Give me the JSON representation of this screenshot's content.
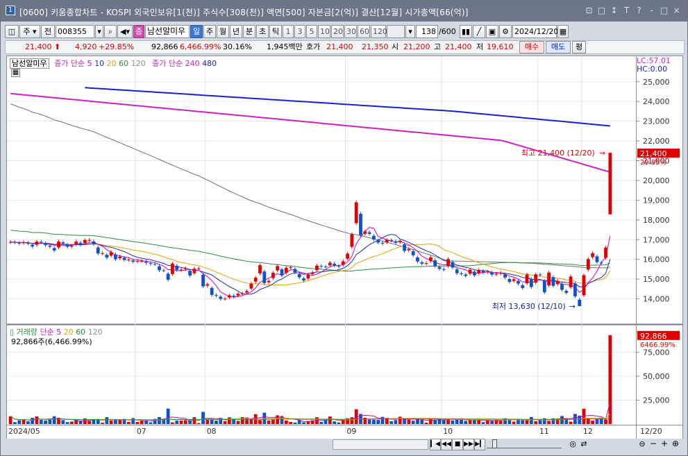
{
  "window": {
    "icon_label": "1",
    "title": "[0600] 키움종합차트 - KOSPI 외국인보유[1(천)] 주식수[308(천)] 액면[500] 자본금[2(억)] 결산[12월] 시가총액[66(억)]",
    "controls": [
      "⊡",
      "□",
      "↕",
      "T",
      "?",
      "-",
      "□",
      "×"
    ]
  },
  "toolbar": {
    "tool_icon": "◫",
    "market": "주",
    "prev_label": "전",
    "code": "008355",
    "name": "남선알미우",
    "periods": [
      "일",
      "주",
      "월",
      "년",
      "분",
      "초",
      "틱"
    ],
    "selected_period": "일",
    "intervals": [
      "1",
      "3",
      "5",
      "10",
      "20",
      "30",
      "60",
      "120"
    ],
    "count": "138",
    "count_total": "/600",
    "date": "2024/12/20",
    "jong_label": "종"
  },
  "quote": {
    "price": "21,400",
    "change": "4,920",
    "change_pct": "+29.85%",
    "volume": "92,866",
    "volume_pct": "6,466.99%",
    "turnover_pct": "30.16%",
    "amount": "1,945백만",
    "bid_label": "호가",
    "ask": "21,400",
    "bid": "21,350",
    "open_label": "시",
    "open": "21,200",
    "high_label": "고",
    "high": "21,400",
    "low_label": "저",
    "low": "19,610",
    "buy_label": "매수",
    "sell_label": "매도",
    "eval_label": "평"
  },
  "price_panel": {
    "legend_name": "남선알미우",
    "ma_label": "종가 단순",
    "ma_periods": [
      "5",
      "10",
      "20",
      "60",
      "120"
    ],
    "ma_colors": [
      "#cc00cc",
      "#1f2fb0",
      "#e8a000",
      "#2e8b3e",
      "#707070"
    ],
    "ma_long_label": "종가 단순",
    "ma_long_periods": [
      "240",
      "480"
    ],
    "ma_long_colors": [
      "#d020c0",
      "#1820d0"
    ],
    "lc": "LC:57.01",
    "hc": "HC:0.00",
    "high_annotation": "최고 21,400 (12/20)",
    "low_annotation": "최저 13,630 (12/10)",
    "last_price_tag": "21,400",
    "last_pct_tag": "29.85%"
  },
  "volume_panel": {
    "legend_name": "거래량",
    "ma_label": "단순",
    "ma_periods": [
      "5",
      "20",
      "60",
      "120"
    ],
    "ma_colors": [
      "#cc00cc",
      "#e8a000",
      "#2e8b3e",
      "#707070"
    ],
    "summary": "92,866주(6,466.99%)",
    "last_volume_tag": "92,866",
    "last_pct_tag": "6466.99%"
  },
  "axis": {
    "price_ticks": [
      "25,000",
      "24,000",
      "23,000",
      "22,000",
      "21,000",
      "20,000",
      "19,000",
      "18,000",
      "17,000",
      "16,000",
      "15,000",
      "14,000"
    ],
    "volume_ticks": [
      "75,000",
      "50,000",
      "25,000"
    ],
    "date_labels": [
      "2024/05",
      "07",
      "08",
      "09",
      "10",
      "11",
      "12"
    ],
    "right_date": "12/20"
  },
  "chart_data": {
    "type": "candlestick",
    "price_range": [
      13000,
      25800
    ],
    "volume_range": [
      0,
      100000
    ],
    "closes": [
      16880,
      16860,
      16800,
      16870,
      16790,
      16650,
      16900,
      16870,
      16720,
      16640,
      16450,
      16900,
      16810,
      16640,
      16680,
      16900,
      16740,
      16980,
      16980,
      16770,
      16300,
      16310,
      16090,
      16370,
      16010,
      16140,
      15970,
      15980,
      15880,
      15920,
      15920,
      15830,
      15770,
      15760,
      15450,
      15440,
      14970,
      15790,
      15470,
      15480,
      15550,
      15180,
      15530,
      15540,
      14630,
      14740,
      14200,
      14170,
      14000,
      14010,
      14180,
      14110,
      14260,
      14270,
      14390,
      14770,
      15070,
      15700,
      14800,
      14910,
      15320,
      15660,
      15190,
      15570,
      15600,
      15340,
      15090,
      14930,
      15220,
      15330,
      15680,
      15640,
      15630,
      15830,
      15690,
      15630,
      15900,
      16290,
      17270,
      18890,
      17230,
      17420,
      17290,
      17010,
      16850,
      16800,
      16990,
      16950,
      16840,
      16940,
      16430,
      16520,
      16210,
      15890,
      15780,
      15810,
      16100,
      15670,
      15520,
      15480,
      16010,
      15590,
      15300,
      15270,
      15160,
      15480,
      15190,
      15460,
      15340,
      15380,
      15230,
      15260,
      15320,
      15080,
      14860,
      14990,
      14770,
      14550,
      15230,
      14600,
      15240,
      15210,
      14330,
      15330,
      14660,
      14910,
      14460,
      14300,
      15130,
      14130,
      13630,
      15200,
      16010,
      16310,
      15860,
      15800,
      16600,
      21400
    ],
    "volumes": [
      8100,
      2000,
      4000,
      4400,
      2900,
      6500,
      8000,
      4400,
      3700,
      4400,
      8200,
      6600,
      4100,
      2100,
      2600,
      4200,
      3000,
      5900,
      3300,
      5200,
      5300,
      1400,
      7200,
      3700,
      4700,
      4200,
      5300,
      2300,
      6200,
      2200,
      3500,
      3900,
      1800,
      5400,
      7300,
      5500,
      16200,
      1800,
      3600,
      3700,
      4100,
      4000,
      7200,
      1100,
      12700,
      4300,
      4500,
      3500,
      6300,
      3100,
      7000,
      5800,
      3300,
      7200,
      6800,
      5000,
      10300,
      4200,
      11900,
      3800,
      4500,
      9100,
      8400,
      3800,
      2200,
      1600,
      4200,
      1900,
      3200,
      3900,
      7100,
      2200,
      4000,
      7900,
      2800,
      1700,
      4700,
      6000,
      7100,
      15500,
      10600,
      6600,
      4700,
      4600,
      4300,
      7500,
      6400,
      3000,
      4200,
      7700,
      5600,
      4500,
      3500,
      6000,
      4400,
      1500,
      5400,
      4000,
      6000,
      4500,
      5800,
      3800,
      4700,
      5300,
      3300,
      3900,
      4800,
      4700,
      2000,
      4200,
      3300,
      4900,
      3300,
      6000,
      5400,
      2600,
      5500,
      4000,
      4500,
      7400,
      3000,
      4100,
      6000,
      3300,
      6000,
      5700,
      8400,
      5700,
      2500,
      10600,
      8800,
      16000,
      6200,
      3700,
      5700,
      6600,
      4900,
      92866
    ]
  }
}
